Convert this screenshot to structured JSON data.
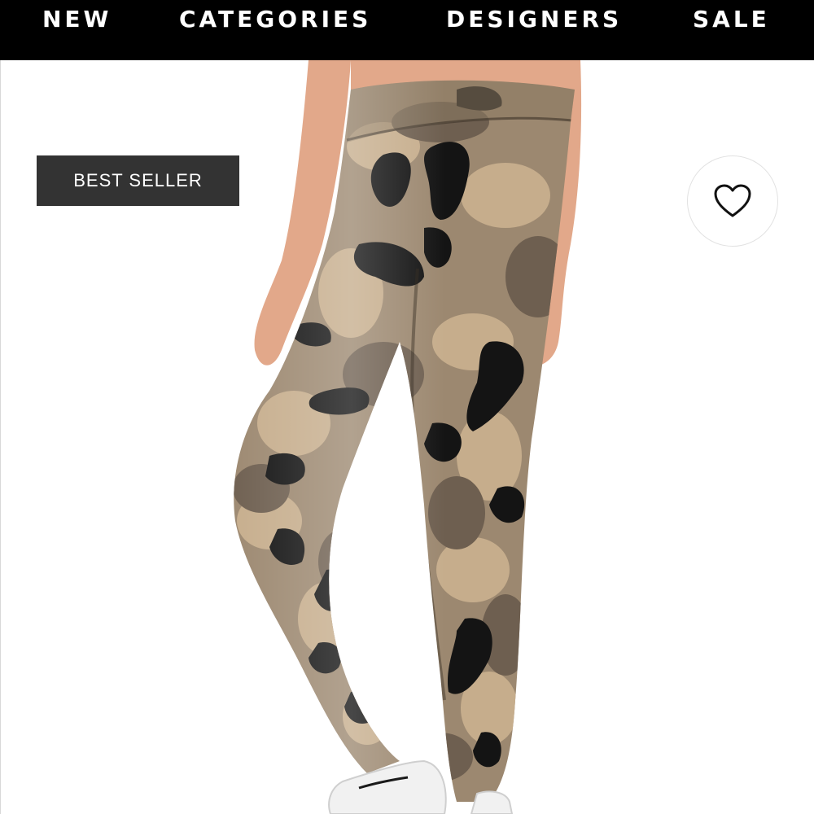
{
  "nav": {
    "items": [
      {
        "label": "NEW"
      },
      {
        "label": "CATEGORIES"
      },
      {
        "label": "DESIGNERS"
      },
      {
        "label": "SALE"
      }
    ]
  },
  "product": {
    "badge": "BEST SELLER",
    "wishlist_icon": "heart-outline-icon",
    "image_alt": "Camo print high-waist leggings"
  },
  "colors": {
    "nav_background": "#000000",
    "nav_text": "#ffffff",
    "badge_background": "#333333",
    "badge_text": "#ffffff",
    "camo_tan": "#b59c7c",
    "camo_olive": "#8a7a62",
    "camo_brown": "#5e5044",
    "camo_black": "#111111"
  }
}
